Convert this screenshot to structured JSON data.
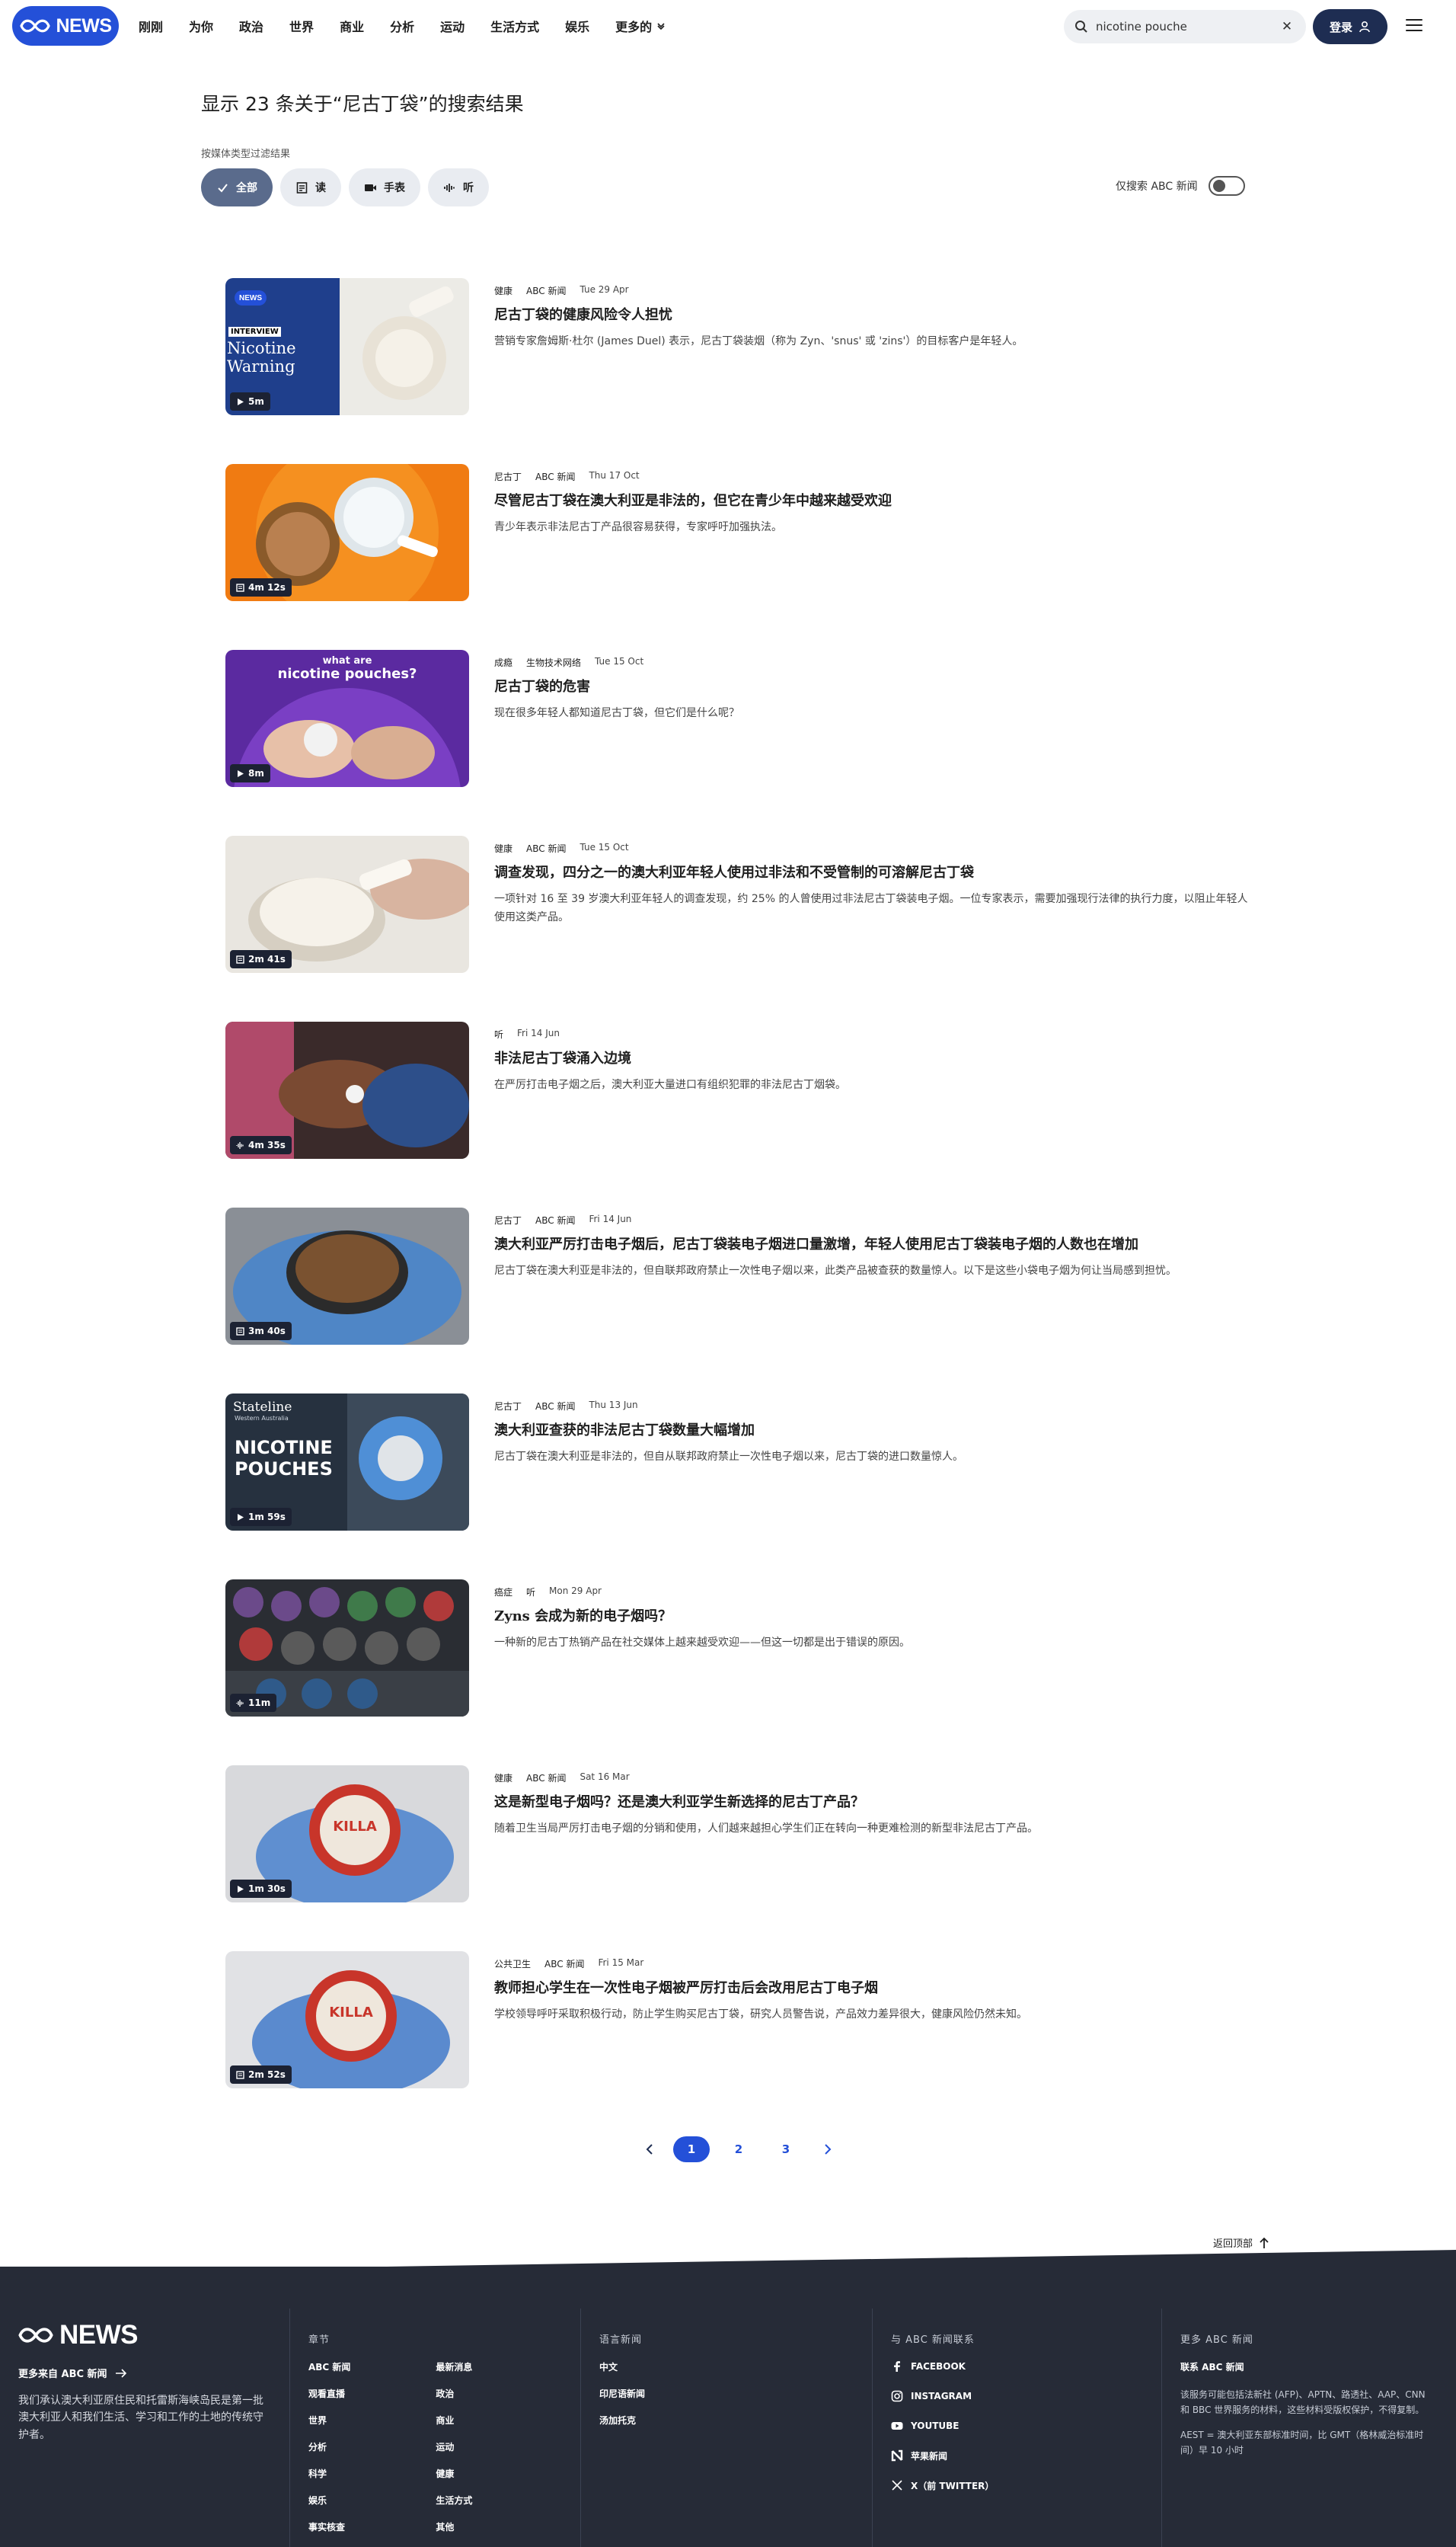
{
  "header": {
    "logo_text": "NEWS",
    "nav": [
      "刚刚",
      "为你",
      "政治",
      "世界",
      "商业",
      "分析",
      "运动",
      "生活方式",
      "娱乐"
    ],
    "nav_more": "更多的",
    "search_value": "nicotine pouche",
    "login_label": "登录"
  },
  "results": {
    "title": "显示 23 条关于“尼古丁袋”的搜索结果",
    "filter_label": "按媒体类型过滤结果",
    "filters": [
      "全部",
      "读",
      "手表",
      "听"
    ],
    "abc_only_label": "仅搜索 ABC 新闻",
    "items": [
      {
        "tags": [
          "健康",
          "ABC 新闻"
        ],
        "date": "Tue 29 Apr",
        "title": "尼古丁袋的健康风险令人担忧",
        "desc": "营销专家詹姆斯·杜尔 (James Duel) 表示，尼古丁袋装烟（称为 Zyn、'snus' 或 'zins'）的目标客户是年轻人。",
        "duration": "5m",
        "thumb_text": [
          "INTERVIEW",
          "Nicotine",
          "Warning"
        ],
        "thumb_logo": "NEWS"
      },
      {
        "tags": [
          "尼古丁",
          "ABC 新闻"
        ],
        "date": "Thu 17 Oct",
        "title": "尽管尼古丁袋在澳大利亚是非法的，但它在青少年中越来越受欢迎",
        "desc": "青少年表示非法尼古丁产品很容易获得，专家呼吁加强执法。",
        "duration": "4m 12s"
      },
      {
        "tags": [
          "成瘾",
          "生物技术网络"
        ],
        "date": "Tue 15 Oct",
        "title": "尼古丁袋的危害",
        "desc": "现在很多年轻人都知道尼古丁袋，但它们是什么呢？",
        "duration": "8m",
        "thumb_text": [
          "what are",
          "nicotine pouches?"
        ]
      },
      {
        "tags": [
          "健康",
          "ABC 新闻"
        ],
        "date": "Tue 15 Oct",
        "title": "调查发现，四分之一的澳大利亚年轻人使用过非法和不受管制的可溶解尼古丁袋",
        "desc": "一项针对 16 至 39 岁澳大利亚年轻人的调查发现，约 25% 的人曾使用过非法尼古丁袋装电子烟。一位专家表示，需要加强现行法律的执行力度，以阻止年轻人使用这类产品。",
        "duration": "2m 41s"
      },
      {
        "tags": [
          "听"
        ],
        "date": "Fri 14 Jun",
        "title": "非法尼古丁袋涌入边境",
        "desc": "在严厉打击电子烟之后，澳大利亚大量进口有组织犯罪的非法尼古丁烟袋。",
        "duration": "4m 35s"
      },
      {
        "tags": [
          "尼古丁",
          "ABC 新闻"
        ],
        "date": "Fri 14 Jun",
        "title": "澳大利亚严厉打击电子烟后，尼古丁袋装电子烟进口量激增，年轻人使用尼古丁袋装电子烟的人数也在增加",
        "desc": "尼古丁袋在澳大利亚是非法的，但自联邦政府禁止一次性电子烟以来，此类产品被查获的数量惊人。以下是这些小袋电子烟为何让当局感到担忧。",
        "duration": "3m 40s"
      },
      {
        "tags": [
          "尼古丁",
          "ABC 新闻"
        ],
        "date": "Thu 13 Jun",
        "title": "澳大利亚查获的非法尼古丁袋数量大幅增加",
        "desc": "尼古丁袋在澳大利亚是非法的，但自从联邦政府禁止一次性电子烟以来，尼古丁袋的进口数量惊人。",
        "duration": "1m 59s",
        "thumb_text": [
          "Stateline",
          "Western Australia",
          "NICOTINE",
          "POUCHES"
        ]
      },
      {
        "tags": [
          "癌症",
          "听"
        ],
        "date": "Mon 29 Apr",
        "title": "Zyns 会成为新的电子烟吗？",
        "desc": "一种新的尼古丁热销产品在社交媒体上越来越受欢迎——但这一切都是出于错误的原因。",
        "duration": "11m"
      },
      {
        "tags": [
          "健康",
          "ABC 新闻"
        ],
        "date": "Sat 16 Mar",
        "title": "这是新型电子烟吗？还是澳大利亚学生新选择的尼古丁产品？",
        "desc": "随着卫生当局严厉打击电子烟的分销和使用，人们越来越担心学生们正在转向一种更难检测的新型非法尼古丁产品。",
        "duration": "1m 30s",
        "thumb_text": [
          "KILLA"
        ]
      },
      {
        "tags": [
          "公共卫生",
          "ABC 新闻"
        ],
        "date": "Fri 15 Mar",
        "title": "教师担心学生在一次性电子烟被严厉打击后会改用尼古丁电子烟",
        "desc": "学校领导呼吁采取积极行动，防止学生购买尼古丁袋，研究人员警告说，产品效力差异很大，健康风险仍然未知。",
        "duration": "2m 52s",
        "thumb_text": [
          "KILLA"
        ]
      }
    ]
  },
  "pagination": {
    "pages": [
      "1",
      "2",
      "3"
    ],
    "current": "1"
  },
  "back_to_top": "返回顶部",
  "footer": {
    "logo_text": "NEWS",
    "more_from": "更多来自 ABC 新闻",
    "acknowledgement": "我们承认澳大利亚原住民和托雷斯海峡岛民是第一批澳大利亚人和我们生活、学习和工作的土地的传统守护者。",
    "sections_title": "章节",
    "sections_col1": [
      "ABC 新闻",
      "观看直播",
      "世界",
      "分析",
      "科学",
      "娱乐",
      "事实核查"
    ],
    "sections_col2": [
      "最新消息",
      "政治",
      "商业",
      "运动",
      "健康",
      "生活方式",
      "其他"
    ],
    "lang_title": "语言新闻",
    "lang_links": [
      "中文",
      "印尼语新闻",
      "汤加托克"
    ],
    "connect_title": "与 ABC 新闻联系",
    "connect_links": [
      "FACEBOOK",
      "INSTAGRAM",
      "YOUTUBE",
      "苹果新闻",
      "X（前 TWITTER）"
    ],
    "more_title": "更多 ABC 新闻",
    "contact": "联系 ABC 新闻",
    "note1": "该服务可能包括法新社 (AFP)、APTN、路透社、AAP、CNN 和 BBC 世界服务的材料，这些材料受版权保护，不得复制。",
    "note2": "AEST = 澳大利亚东部标准时间，比 GMT（格林威治标准时间）早 10 小时"
  }
}
